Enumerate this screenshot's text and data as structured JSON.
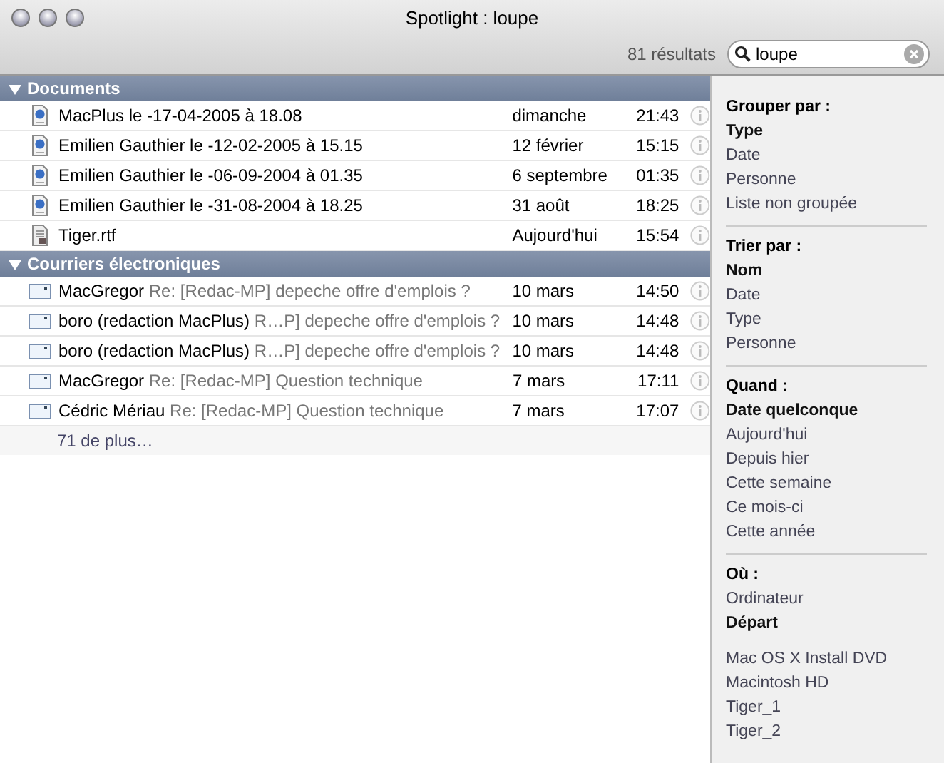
{
  "window": {
    "title": "Spotlight : loupe"
  },
  "toolbar": {
    "result_count": "81 résultats",
    "search": {
      "value": "loupe"
    }
  },
  "groups": [
    {
      "title": "Documents",
      "expanded": true,
      "rows": [
        {
          "kind": "web-document",
          "name": "MacPlus le -17-04-2005 à 18.08",
          "date": "dimanche",
          "time": "21:43"
        },
        {
          "kind": "web-document",
          "name": "Emilien Gauthier le -12-02-2005 à 15.15",
          "date": "12 février",
          "time": "15:15"
        },
        {
          "kind": "web-document",
          "name": "Emilien Gauthier le -06-09-2004 à 01.35",
          "date": "6 septembre",
          "time": "01:35"
        },
        {
          "kind": "web-document",
          "name": "Emilien Gauthier le -31-08-2004 à 18.25",
          "date": "31 août",
          "time": "18:25"
        },
        {
          "kind": "text-document",
          "name": "Tiger.rtf",
          "date": "Aujourd'hui",
          "time": "15:54"
        }
      ]
    },
    {
      "title": "Courriers électroniques",
      "expanded": true,
      "rows": [
        {
          "kind": "mail",
          "name": "MacGregor",
          "subject": "Re: [Redac-MP] depeche offre d'emplois ?",
          "date": "10 mars",
          "time": "14:50"
        },
        {
          "kind": "mail",
          "name": "boro (redaction MacPlus)",
          "subject": "R…P] depeche offre d'emplois ?",
          "date": "10 mars",
          "time": "14:48"
        },
        {
          "kind": "mail",
          "name": "boro (redaction MacPlus)",
          "subject": "R…P] depeche offre d'emplois ?",
          "date": "10 mars",
          "time": "14:48"
        },
        {
          "kind": "mail",
          "name": "MacGregor",
          "subject": "Re: [Redac-MP] Question technique",
          "date": "7 mars",
          "time": "17:11"
        },
        {
          "kind": "mail",
          "name": "Cédric Mériau",
          "subject": "Re: [Redac-MP] Question technique",
          "date": "7 mars",
          "time": "17:07"
        }
      ],
      "more": "71 de plus…"
    }
  ],
  "sidebar": {
    "sections": [
      {
        "title": "Grouper par :",
        "items": [
          {
            "label": "Type",
            "selected": true
          },
          {
            "label": "Date",
            "selected": false
          },
          {
            "label": "Personne",
            "selected": false
          },
          {
            "label": "Liste non groupée",
            "selected": false
          }
        ]
      },
      {
        "title": "Trier par :",
        "items": [
          {
            "label": "Nom",
            "selected": true
          },
          {
            "label": "Date",
            "selected": false
          },
          {
            "label": "Type",
            "selected": false
          },
          {
            "label": "Personne",
            "selected": false
          }
        ]
      },
      {
        "title": "Quand :",
        "items": [
          {
            "label": "Date quelconque",
            "selected": true
          },
          {
            "label": "Aujourd'hui",
            "selected": false
          },
          {
            "label": "Depuis hier",
            "selected": false
          },
          {
            "label": "Cette semaine",
            "selected": false
          },
          {
            "label": "Ce mois-ci",
            "selected": false
          },
          {
            "label": "Cette année",
            "selected": false
          }
        ]
      },
      {
        "title": "Où :",
        "items": [
          {
            "label": "Ordinateur",
            "selected": false
          },
          {
            "label": "Départ",
            "selected": true
          }
        ],
        "volumes": [
          {
            "label": "Mac OS X Install DVD",
            "selected": false
          },
          {
            "label": "Macintosh HD",
            "selected": false
          },
          {
            "label": "Tiger_1",
            "selected": false
          },
          {
            "label": "Tiger_2",
            "selected": false
          }
        ]
      }
    ]
  }
}
